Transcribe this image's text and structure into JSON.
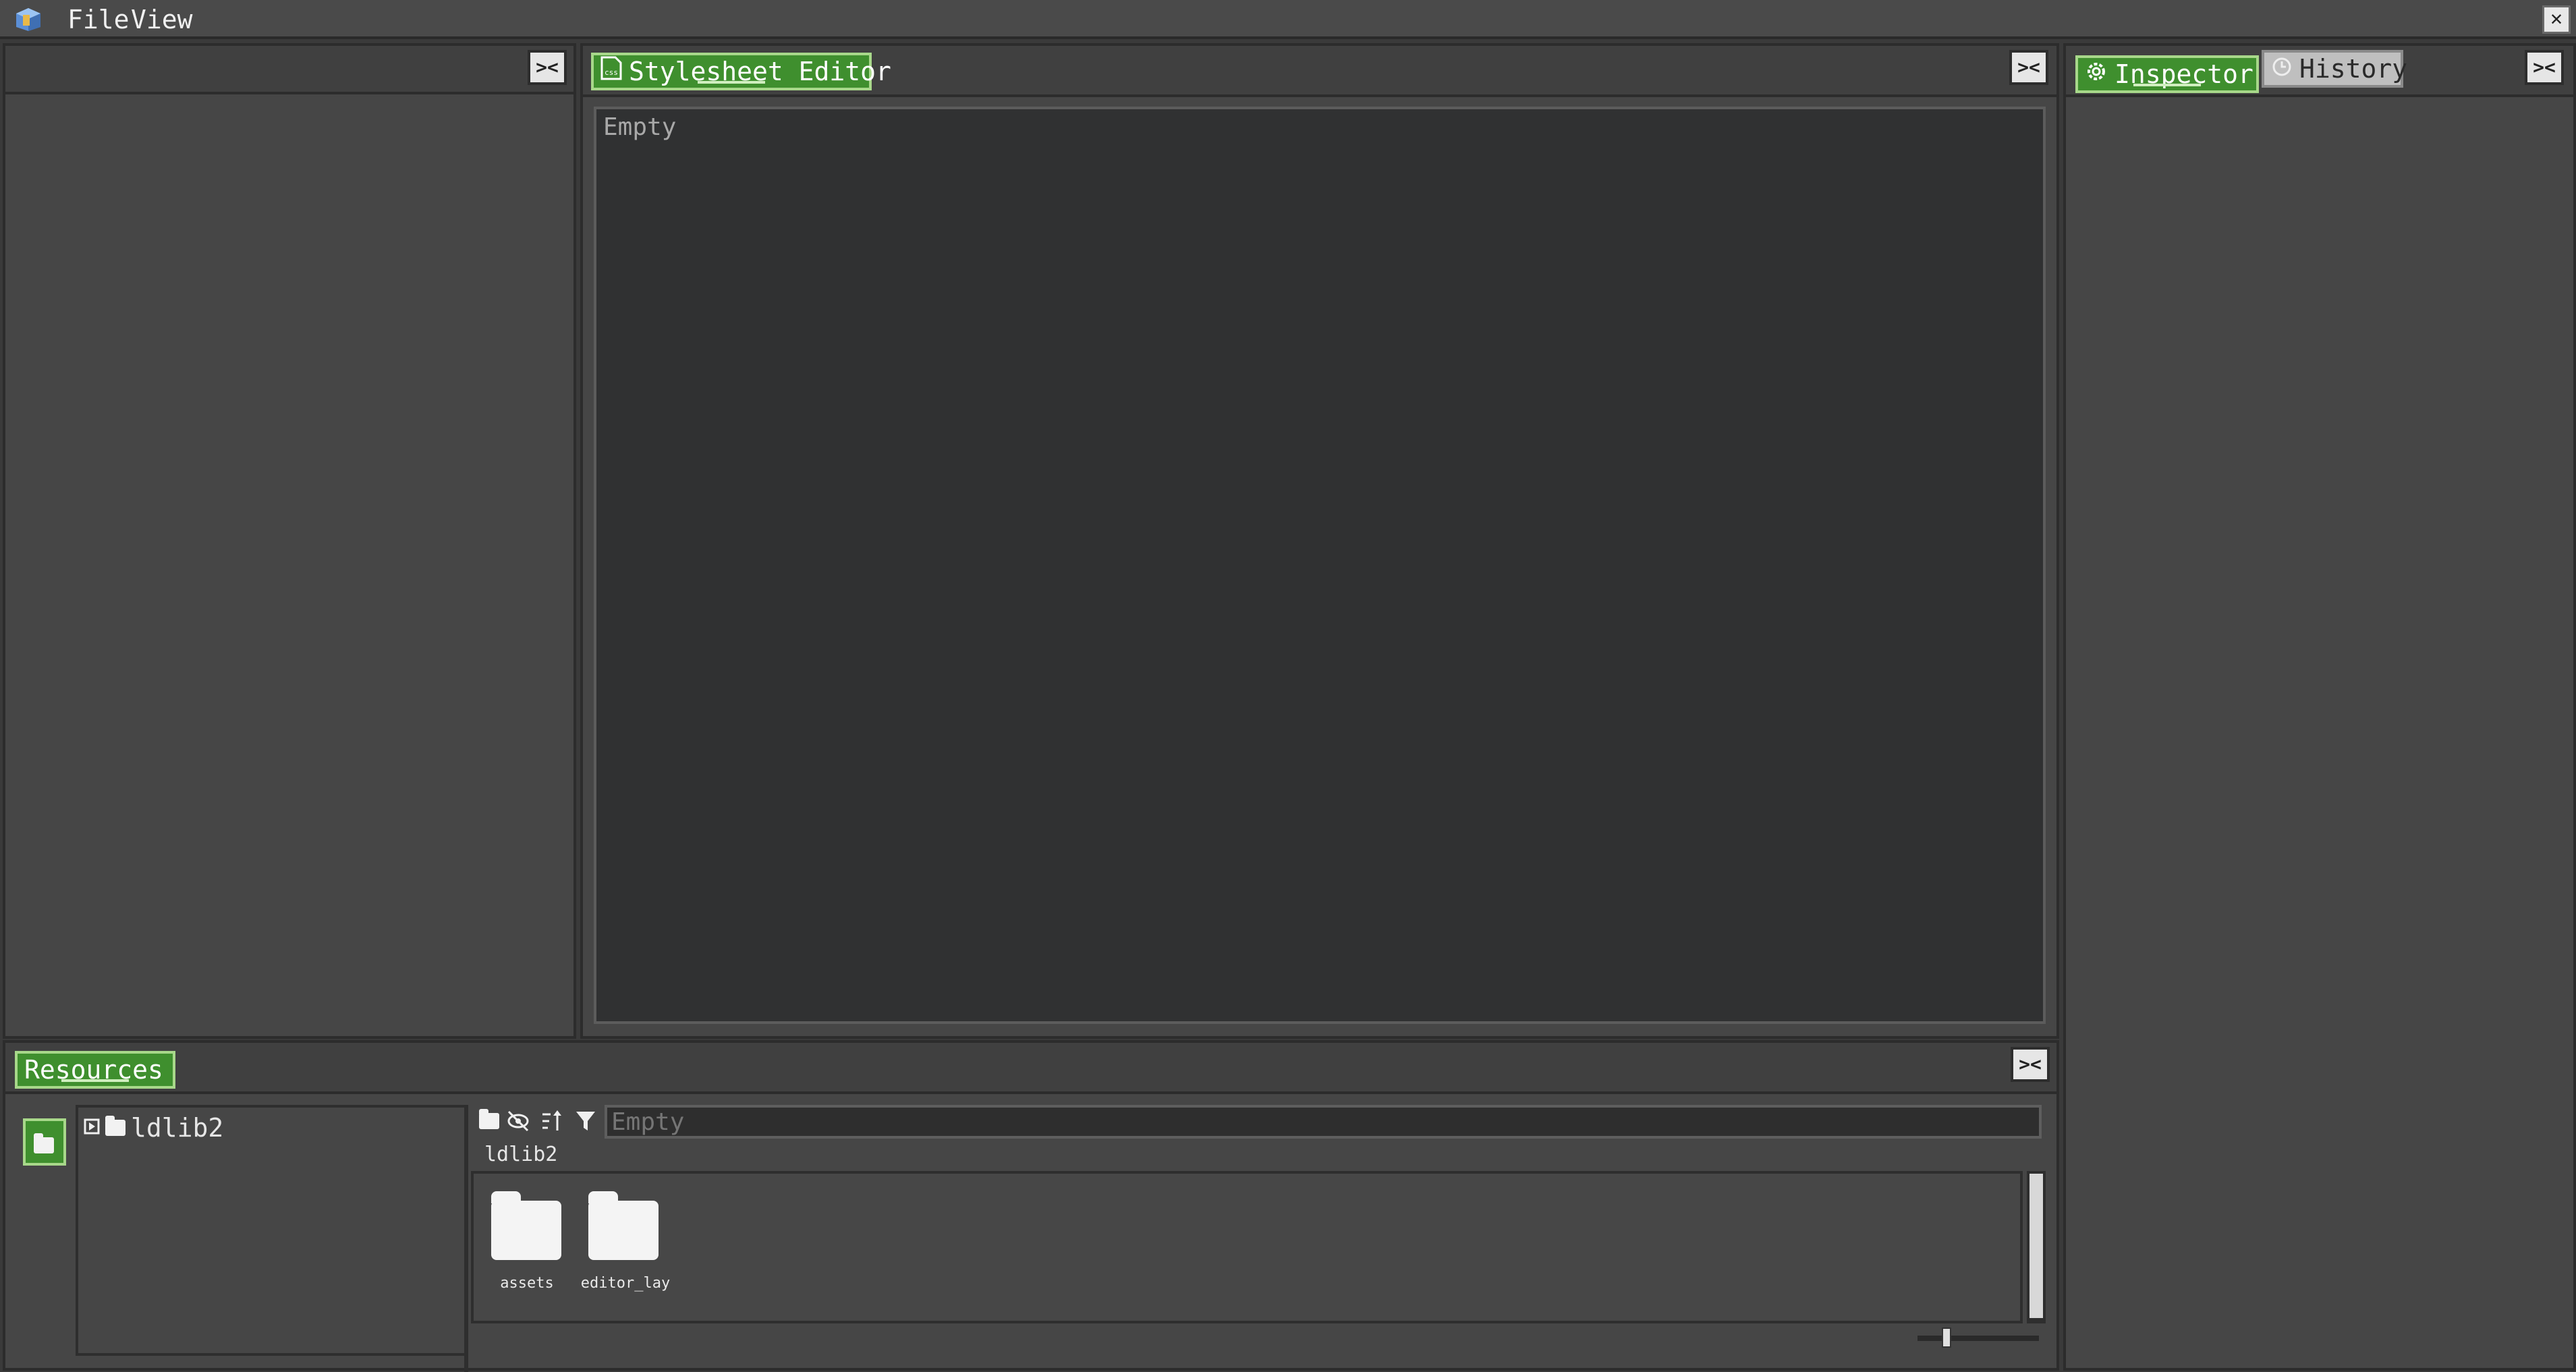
{
  "menu": {
    "file": "File",
    "view": "View",
    "close_glyph": "✕"
  },
  "left_panel": {
    "collapse_glyph": "><"
  },
  "stylesheet_editor": {
    "tab_label": "Stylesheet Editor",
    "tab_icon": "css-file-icon",
    "placeholder": "Empty",
    "collapse_glyph": "><"
  },
  "right_panel": {
    "tabs": [
      {
        "label": "Inspector",
        "icon": "gear-icon",
        "active": true
      },
      {
        "label": "History",
        "icon": "clock-icon",
        "active": false
      }
    ],
    "collapse_glyph": "><"
  },
  "resources": {
    "tab_label": "Resources",
    "collapse_glyph": "><",
    "tree": [
      {
        "label": "ldlib2",
        "icon": "folder-icon"
      }
    ],
    "search_placeholder": "Empty",
    "current_path": "ldlib2",
    "items": [
      {
        "name": "assets",
        "icon": "folder-icon"
      },
      {
        "name": "editor_lay",
        "icon": "folder-icon"
      }
    ]
  },
  "colors": {
    "accent_green": "#3f8f2e",
    "panel_bg": "#464646",
    "editor_bg": "#303132"
  }
}
